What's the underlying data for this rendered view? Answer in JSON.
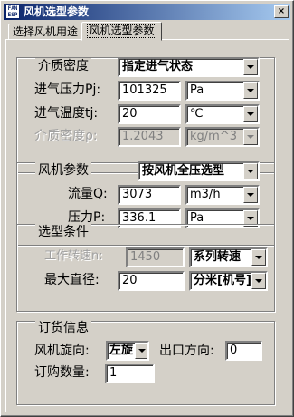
{
  "window": {
    "title": "风机选型参数",
    "icon_text": "FAN\nESP",
    "close": "×"
  },
  "tabs": [
    "选择风机用途",
    "风机选型参数"
  ],
  "medium": {
    "group_title": "介质密度",
    "mode": "指定进气状态",
    "pressure": {
      "label": "进气压力Pj:",
      "value": "101325",
      "unit": "Pa"
    },
    "temperature": {
      "label": "进气温度tj:",
      "value": "20",
      "unit": "℃"
    },
    "density": {
      "label": "介质密度ρ:",
      "value": "1.2043",
      "unit": "kg/m^3"
    }
  },
  "fan": {
    "group_title": "风机参数",
    "mode": "按风机全压选型",
    "flow": {
      "label": "流量Q:",
      "value": "3073",
      "unit": "m3/h"
    },
    "pressure": {
      "label": "压力P:",
      "value": "336.1",
      "unit": "Pa"
    }
  },
  "selection": {
    "group_title": "选型条件",
    "speed": {
      "label": "工作转速n:",
      "value": "1450",
      "option": "系列转速"
    },
    "diameter": {
      "label": "最大直径:",
      "value": "20",
      "unit": "分米[机号]"
    }
  },
  "order": {
    "group_title": "订货信息",
    "rotation": {
      "label": "风机旋向:",
      "value": "左旋"
    },
    "outlet": {
      "label": "出口方向:",
      "value": "0"
    },
    "quantity": {
      "label": "订购数量:",
      "value": "1"
    }
  }
}
